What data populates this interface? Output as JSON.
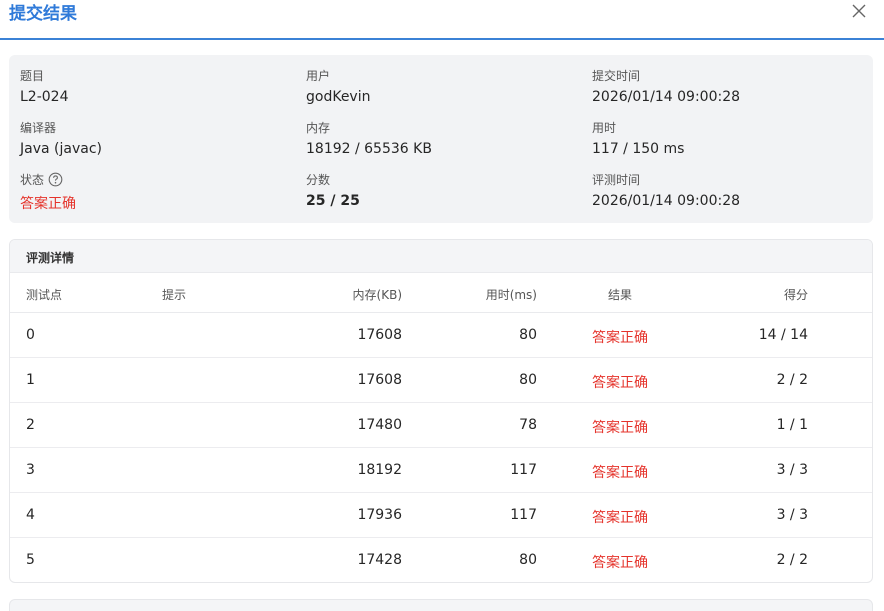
{
  "dialog": {
    "title": "提交结果"
  },
  "summary": {
    "problem": {
      "label": "题目",
      "value": "L2-024"
    },
    "user": {
      "label": "用户",
      "value": "godKevin"
    },
    "submit_time": {
      "label": "提交时间",
      "value": "2026/01/14 09:00:28"
    },
    "compiler": {
      "label": "编译器",
      "value": "Java (javac)"
    },
    "memory": {
      "label": "内存",
      "value": "18192 / 65536 KB"
    },
    "time_used": {
      "label": "用时",
      "value": "117 / 150 ms"
    },
    "status": {
      "label": "状态",
      "value": "答案正确"
    },
    "score": {
      "label": "分数",
      "value": "25 / 25"
    },
    "judge_time": {
      "label": "评测时间",
      "value": "2026/01/14 09:00:28"
    }
  },
  "details": {
    "title": "评测详情",
    "columns": {
      "case": "测试点",
      "hint": "提示",
      "memory": "内存(KB)",
      "time": "用时(ms)",
      "result": "结果",
      "score": "得分"
    },
    "rows": [
      {
        "case": "0",
        "hint": "",
        "memory": "17608",
        "time": "80",
        "result": "答案正确",
        "score": "14 / 14"
      },
      {
        "case": "1",
        "hint": "",
        "memory": "17608",
        "time": "80",
        "result": "答案正确",
        "score": "2 / 2"
      },
      {
        "case": "2",
        "hint": "",
        "memory": "17480",
        "time": "78",
        "result": "答案正确",
        "score": "1 / 1"
      },
      {
        "case": "3",
        "hint": "",
        "memory": "18192",
        "time": "117",
        "result": "答案正确",
        "score": "3 / 3"
      },
      {
        "case": "4",
        "hint": "",
        "memory": "17936",
        "time": "117",
        "result": "答案正确",
        "score": "3 / 3"
      },
      {
        "case": "5",
        "hint": "",
        "memory": "17428",
        "time": "80",
        "result": "答案正确",
        "score": "2 / 2"
      }
    ]
  },
  "colors": {
    "accent": "#2f7ad9",
    "success": "#e5332b",
    "panel": "#f2f3f5"
  },
  "icons": {
    "close": "close-icon",
    "help": "question-circle-icon"
  }
}
